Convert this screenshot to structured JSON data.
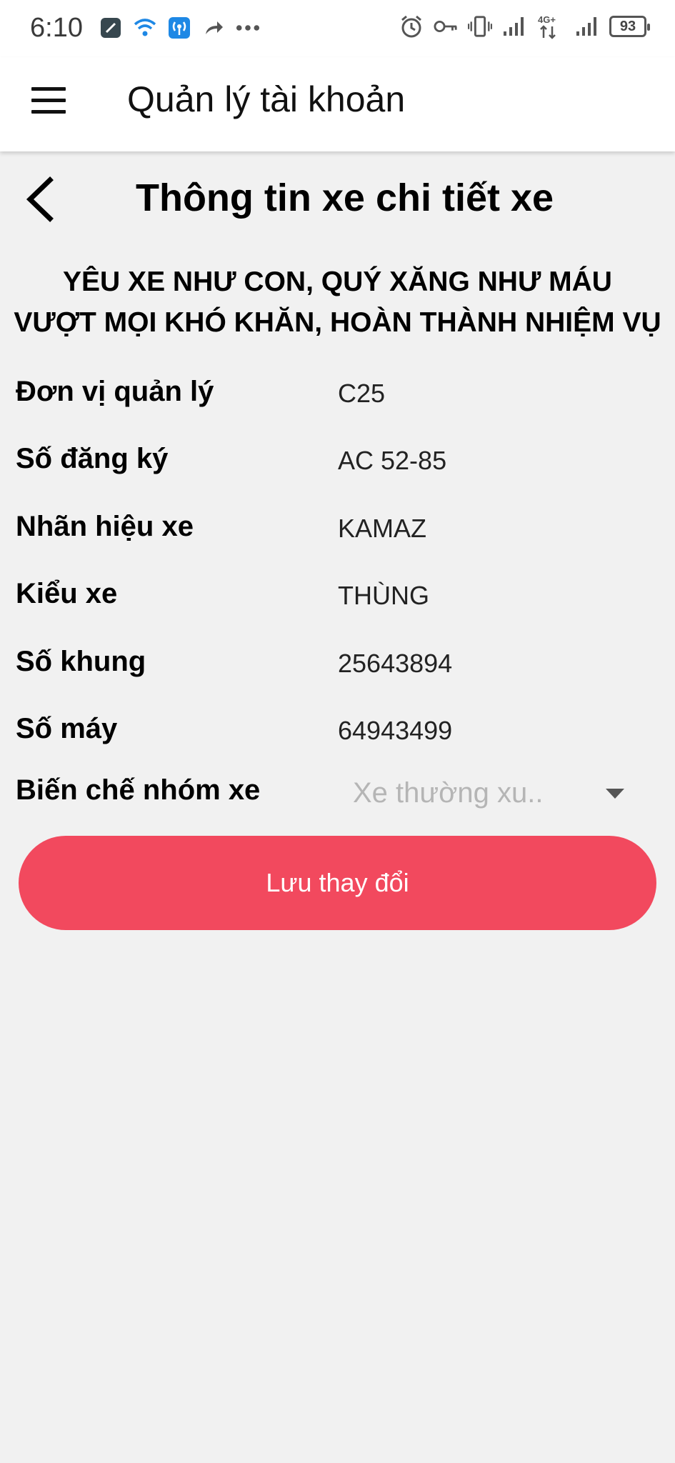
{
  "status_bar": {
    "time": "6:10",
    "battery": "93",
    "network": "4G+",
    "left_icons": [
      "app-icon",
      "wifi-icon",
      "hotspot-icon",
      "share-icon",
      "more-dots-icon"
    ],
    "right_icons": [
      "alarm-icon",
      "key-icon",
      "vibrate-icon",
      "signal-icon",
      "signal-4g-icon",
      "signal-icon",
      "battery-icon"
    ]
  },
  "app_bar": {
    "title": "Quản lý tài khoản",
    "menu_icon": "hamburger-menu-icon"
  },
  "page": {
    "title": "Thông tin xe chi tiết xe",
    "back_icon": "chevron-left-icon",
    "slogan_line1": "YÊU XE NHƯ CON, QUÝ XĂNG NHƯ MÁU",
    "slogan_line2": "VƯỢT MỌI KHÓ KHĂN, HOÀN THÀNH NHIỆM VỤ"
  },
  "fields": [
    {
      "label": "Đơn vị quản lý",
      "value": "C25"
    },
    {
      "label": "Số đăng ký",
      "value": "AC 52-85"
    },
    {
      "label": "Nhãn hiệu xe",
      "value": "KAMAZ"
    },
    {
      "label": "Kiểu xe",
      "value": "THÙNG"
    },
    {
      "label": "Số khung",
      "value": "25643894"
    },
    {
      "label": "Số máy",
      "value": "64943499"
    }
  ],
  "group_select": {
    "label": "Biến chế nhóm xe",
    "value": "Xe thường xu.."
  },
  "save_button": {
    "label": "Lưu thay đổi"
  },
  "colors": {
    "accent": "#f2495e",
    "background": "#f1f1f1",
    "app_bar": "#ffffff"
  }
}
